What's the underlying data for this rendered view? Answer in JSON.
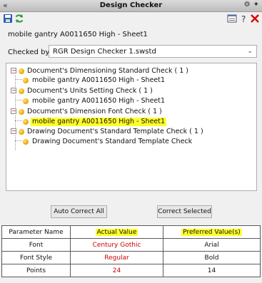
{
  "window": {
    "title": "Design Checker",
    "collapse_glyph": "«"
  },
  "header": {
    "sheet_name": "mobile gantry A0011650 High - Sheet1"
  },
  "checked_by": {
    "label": "Checked by :",
    "value": "RGR Design Checker 1.swstd"
  },
  "tree": [
    {
      "label": "Document's Dimensioning Standard Check ( 1 )",
      "child": "mobile gantry A0011650 High - Sheet1"
    },
    {
      "label": "Document's Units Setting Check ( 1 )",
      "child": "mobile gantry A0011650 High - Sheet1"
    },
    {
      "label": "Document's Dimension Font Check ( 1 )",
      "child": "mobile gantry A0011650 High - Sheet1"
    },
    {
      "label": "Drawing Document's Standard Template Check ( 1 )",
      "child": "Drawing Document's Standard Template Check"
    }
  ],
  "buttons": {
    "auto_correct": "Auto Correct All",
    "correct_selected": "Correct Selected"
  },
  "results": {
    "headers": [
      "Parameter Name",
      "Actual Value",
      "Preferred Value(s)"
    ],
    "rows": [
      [
        "Font",
        "Century Gothic",
        "Arial"
      ],
      [
        "Font Style",
        "Regular",
        "Bold"
      ],
      [
        "Points",
        "24",
        "14"
      ]
    ]
  },
  "icons": {
    "save": "save-icon",
    "refresh": "refresh-icon",
    "report": "report-icon",
    "help": "help-icon",
    "close": "close-icon",
    "gear": "gear-icon",
    "pin": "pin-icon"
  },
  "colors": {
    "highlight": "#ffff2a",
    "mismatch": "#cc0000",
    "status_dot": "#e8a400"
  }
}
